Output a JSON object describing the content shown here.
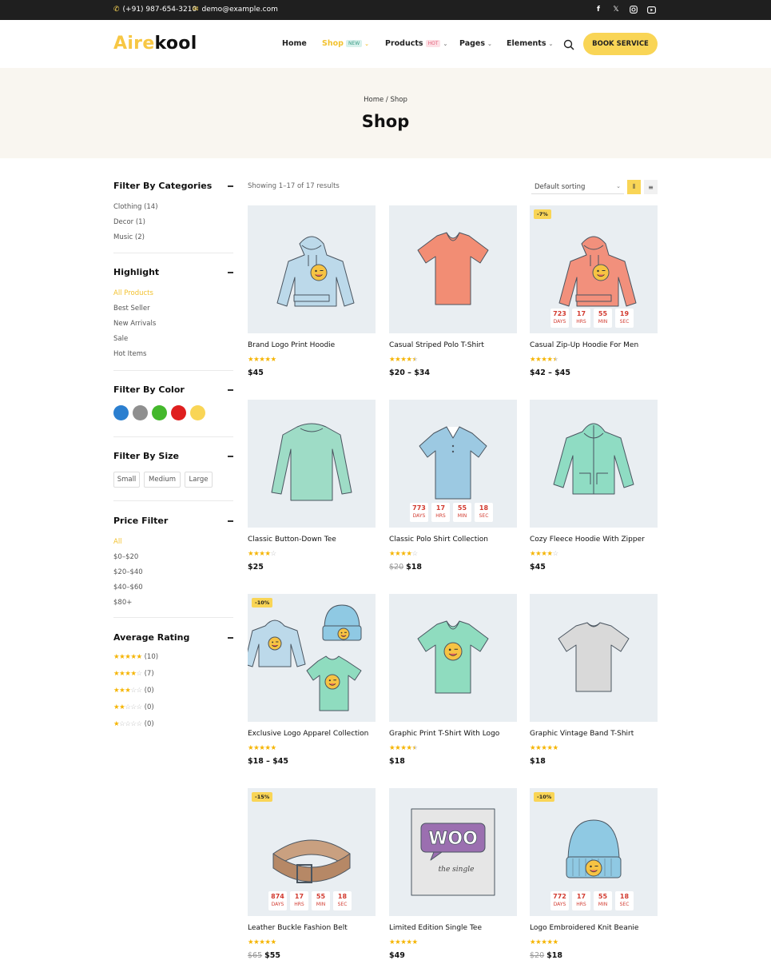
{
  "topbar": {
    "phone": "(+91) 987-654-3210",
    "email": "demo@example.com",
    "social": [
      "facebook-icon",
      "x-icon",
      "instagram-icon",
      "youtube-icon"
    ]
  },
  "header": {
    "logo_part1": "Aire",
    "logo_part2": "kool",
    "nav": [
      {
        "label": "Home",
        "badge": "",
        "dropdown": false
      },
      {
        "label": "Shop",
        "badge": "NEW",
        "dropdown": true,
        "active": true
      },
      {
        "label": "Products",
        "badge": "HOT",
        "dropdown": true
      },
      {
        "label": "Pages",
        "badge": "",
        "dropdown": true
      },
      {
        "label": "Elements",
        "badge": "",
        "dropdown": true
      }
    ],
    "book_button": "BOOK SERVICE"
  },
  "hero": {
    "crumb_home": "Home",
    "crumb_sep": "/",
    "crumb_current": "Shop",
    "title": "Shop"
  },
  "sidebar": {
    "categories": {
      "title": "Filter By Categories",
      "items": [
        "Clothing (14)",
        "Decor (1)",
        "Music (2)"
      ]
    },
    "highlight": {
      "title": "Highlight",
      "items": [
        "All Products",
        "Best Seller",
        "New Arrivals",
        "Sale",
        "Hot Items"
      ]
    },
    "color": {
      "title": "Filter By Color",
      "colors": [
        "#2b7fd0",
        "#8f8f8f",
        "#44b82c",
        "#df1f1f",
        "#f9d556"
      ]
    },
    "size": {
      "title": "Filter By Size",
      "items": [
        "Small",
        "Medium",
        "Large"
      ]
    },
    "price": {
      "title": "Price Filter",
      "items": [
        "All",
        "$0–$20",
        "$20–$40",
        "$40–$60",
        "$80+"
      ]
    },
    "rating": {
      "title": "Average Rating",
      "rows": [
        {
          "stars": 5,
          "count": "(10)"
        },
        {
          "stars": 4,
          "count": "(7)"
        },
        {
          "stars": 3,
          "count": "(0)"
        },
        {
          "stars": 2,
          "count": "(0)"
        },
        {
          "stars": 1,
          "count": "(0)"
        }
      ]
    }
  },
  "toolbar": {
    "results": "Showing 1–17 of 17 results",
    "sort": "Default sorting"
  },
  "products": [
    {
      "name": "Brand Logo Print Hoodie",
      "rating": 5,
      "old_price": "",
      "price": "$45",
      "badge": "",
      "countdown": null,
      "kind": "hoodie",
      "color": "#bcd9ea"
    },
    {
      "name": "Casual Striped Polo T-Shirt",
      "rating": 4.5,
      "old_price": "",
      "price": "$20 – $34",
      "badge": "",
      "countdown": null,
      "kind": "vtee",
      "color": "#f28d74"
    },
    {
      "name": "Casual Zip-Up Hoodie For Men",
      "rating": 4.5,
      "old_price": "",
      "price": "$42 – $45",
      "badge": "-7%",
      "countdown": [
        "723",
        "17",
        "55",
        "19"
      ],
      "kind": "hoodie",
      "color": "#f2907c"
    },
    {
      "name": "Classic Button-Down Tee",
      "rating": 4,
      "old_price": "",
      "price": "$25",
      "badge": "",
      "countdown": null,
      "kind": "longsleeve",
      "color": "#9edcc6"
    },
    {
      "name": "Classic Polo Shirt Collection",
      "rating": 4,
      "old_price": "$20",
      "price": "$18",
      "badge": "",
      "countdown": [
        "773",
        "17",
        "55",
        "18"
      ],
      "kind": "polo",
      "color": "#9cc9e2"
    },
    {
      "name": "Cozy Fleece Hoodie With Zipper",
      "rating": 4,
      "old_price": "",
      "price": "$45",
      "badge": "",
      "countdown": null,
      "kind": "zip",
      "color": "#8fdcc3"
    },
    {
      "name": "Exclusive Logo Apparel Collection",
      "rating": 5,
      "old_price": "",
      "price": "$18 – $45",
      "badge": "-10%",
      "countdown": null,
      "kind": "collection",
      "color": "#bcd9ea"
    },
    {
      "name": "Graphic Print T-Shirt With Logo",
      "rating": 4.5,
      "old_price": "",
      "price": "$18",
      "badge": "",
      "countdown": null,
      "kind": "vtee",
      "color": "#8fdcbf"
    },
    {
      "name": "Graphic Vintage Band T-Shirt",
      "rating": 5,
      "old_price": "",
      "price": "$18",
      "badge": "",
      "countdown": null,
      "kind": "tee",
      "color": "#d9d9d9"
    },
    {
      "name": "Leather Buckle Fashion Belt",
      "rating": 5,
      "old_price": "$65",
      "price": "$55",
      "badge": "-15%",
      "countdown": [
        "874",
        "17",
        "55",
        "18"
      ],
      "kind": "belt",
      "color": "#c9a080"
    },
    {
      "name": "Limited Edition Single Tee",
      "rating": 5,
      "old_price": "",
      "price": "$49",
      "badge": "",
      "countdown": null,
      "kind": "woo",
      "color": "#9b6fb0"
    },
    {
      "name": "Logo Embroidered Knit Beanie",
      "rating": 5,
      "old_price": "$20",
      "price": "$18",
      "badge": "-10%",
      "countdown": [
        "772",
        "17",
        "55",
        "18"
      ],
      "kind": "beanie",
      "color": "#8fc9e3"
    }
  ],
  "countdown_labels": [
    "DAYS",
    "HRS",
    "MIN",
    "SEC"
  ],
  "woo_text": "WOO",
  "woo_sub": "the single",
  "colors": {
    "accent": "#f9d556",
    "accent_text": "#f2c230",
    "topbar": "#1f1f1f",
    "hero": "#f9f6f0",
    "countdown": "#d23b30",
    "new_badge": "#d8f1ec",
    "hot_badge": "#fde0e6"
  }
}
